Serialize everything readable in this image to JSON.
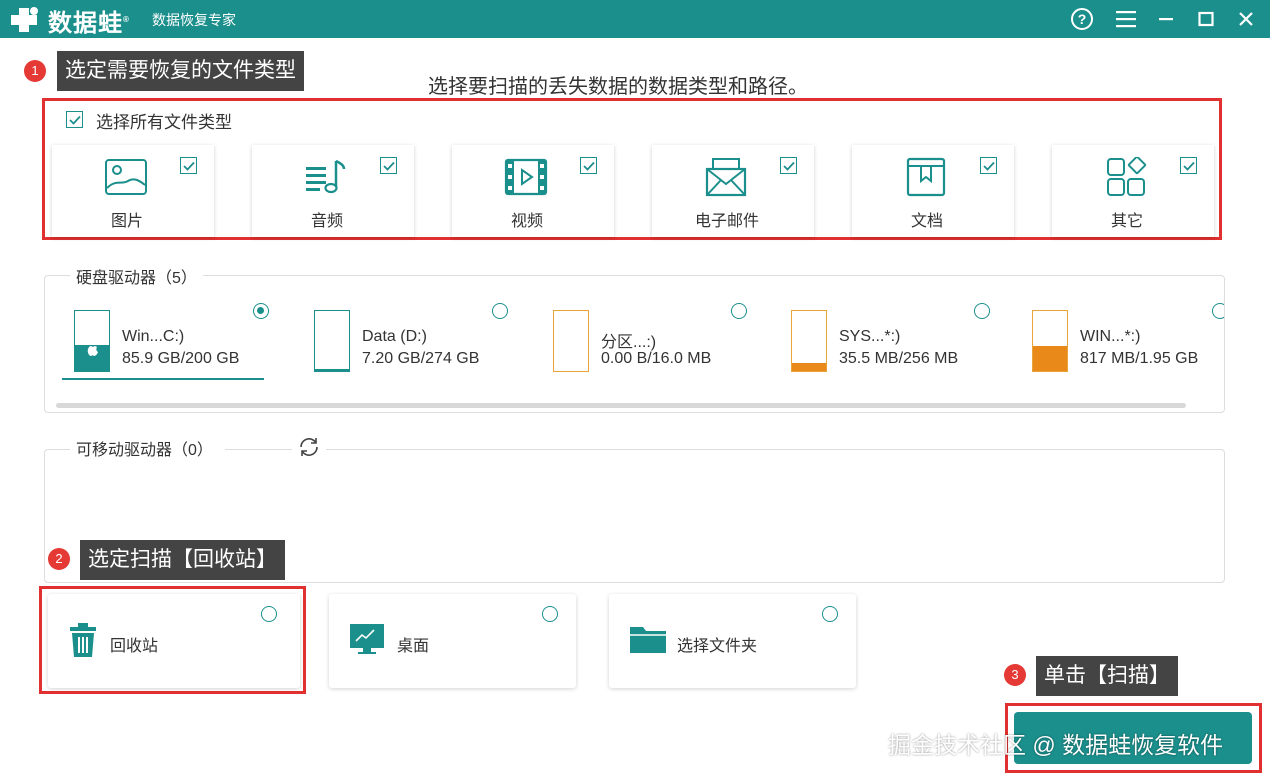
{
  "app": {
    "logo_text": "数据蛙",
    "logo_mark": "®",
    "subtitle": "数据恢复专家"
  },
  "titlebar_icons": [
    "help-icon",
    "menu-icon",
    "minimize-icon",
    "maximize-icon",
    "close-icon"
  ],
  "heading": "选择要扫描的丢失数据的数据类型和路径。",
  "annotations": {
    "step1": {
      "num": "1",
      "text": "选定需要恢复的文件类型"
    },
    "step2": {
      "num": "2",
      "text": "选定扫描【回收站】"
    },
    "step3": {
      "num": "3",
      "text": "单击【扫描】"
    }
  },
  "file_types": {
    "select_all_label": "选择所有文件类型",
    "select_all_checked": true,
    "items": [
      {
        "label": "图片",
        "icon": "image-icon",
        "checked": true
      },
      {
        "label": "音频",
        "icon": "music-icon",
        "checked": true
      },
      {
        "label": "视频",
        "icon": "video-icon",
        "checked": true
      },
      {
        "label": "电子邮件",
        "icon": "email-icon",
        "checked": true
      },
      {
        "label": "文档",
        "icon": "document-icon",
        "checked": true
      },
      {
        "label": "其它",
        "icon": "other-icon",
        "checked": true
      }
    ]
  },
  "hard_drives": {
    "label": "硬盘驱动器（5）",
    "items": [
      {
        "name": "Win...C:)",
        "size": "85.9 GB/200 GB",
        "used_fraction": 0.43,
        "fill_color": "#1b8f8c",
        "selected": true,
        "icon": "windows-drive-icon"
      },
      {
        "name": "Data (D:)",
        "size": "7.20 GB/274 GB",
        "used_fraction": 0.03,
        "fill_color": "#1b8f8c",
        "selected": false,
        "icon": "drive-icon"
      },
      {
        "name": "分区...:)",
        "size": "0.00  B/16.0 MB",
        "used_fraction": 0.0,
        "fill_color": "#e8a33a",
        "selected": false,
        "icon": "drive-icon"
      },
      {
        "name": "SYS...*:)",
        "size": "35.5 MB/256 MB",
        "used_fraction": 0.14,
        "fill_color": "#e8891a",
        "selected": false,
        "icon": "drive-icon"
      },
      {
        "name": "WIN...*:)",
        "size": "817 MB/1.95 GB",
        "used_fraction": 0.41,
        "fill_color": "#e8891a",
        "selected": false,
        "icon": "drive-icon"
      }
    ]
  },
  "removable_drives": {
    "label": "可移动驱动器（0）",
    "refresh_icon": "refresh-icon"
  },
  "locations": [
    {
      "label": "回收站",
      "icon": "recycle-bin-icon",
      "selected": false
    },
    {
      "label": "桌面",
      "icon": "desktop-icon",
      "selected": false
    },
    {
      "label": "选择文件夹",
      "icon": "folder-icon",
      "selected": false
    }
  ],
  "scan_button": {
    "label": ""
  },
  "watermark": "掘金技术社区 @ 数据蛙恢复软件",
  "colors": {
    "accent": "#1b8f8c",
    "annotation_red": "#e03030",
    "orange": "#e8891a"
  }
}
